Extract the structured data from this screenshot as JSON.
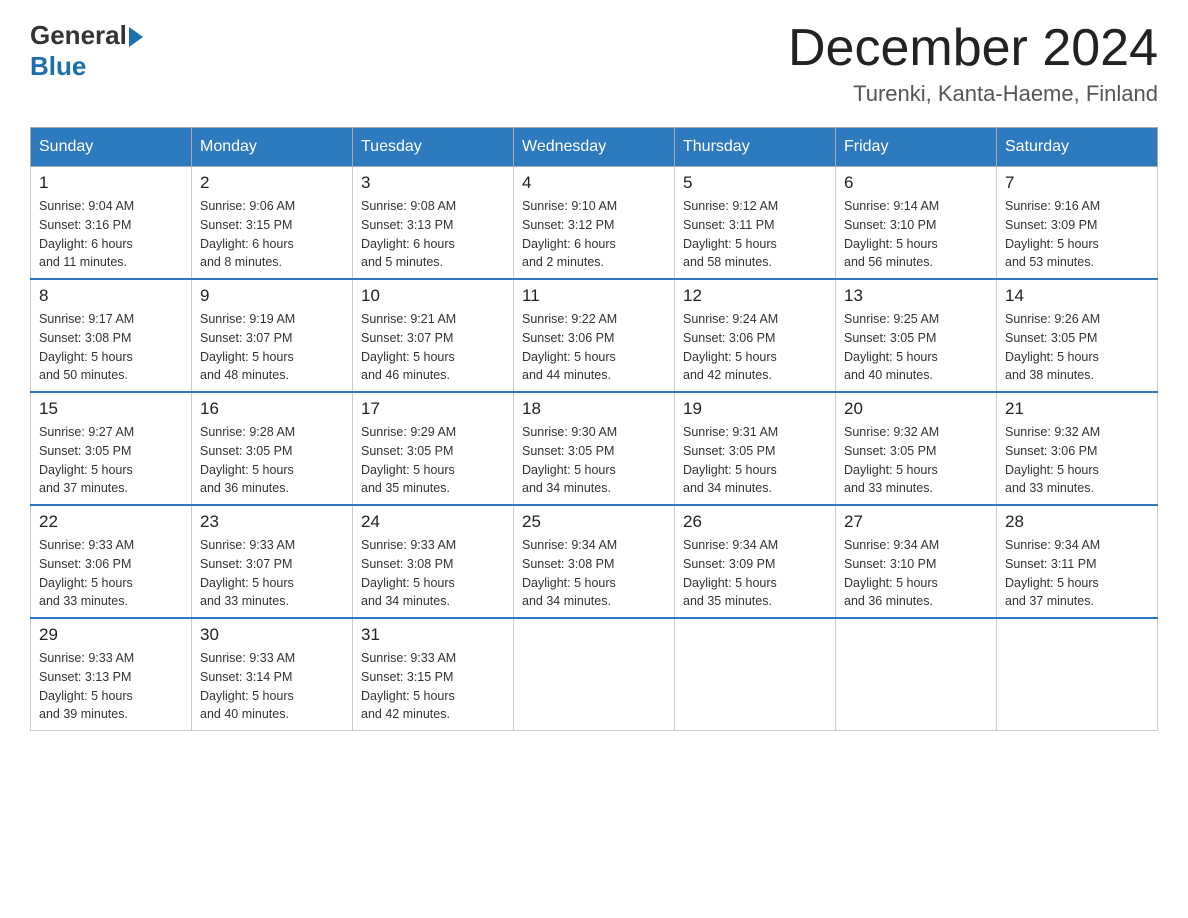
{
  "logo": {
    "general": "General",
    "blue": "Blue"
  },
  "title": "December 2024",
  "location": "Turenki, Kanta-Haeme, Finland",
  "days_of_week": [
    "Sunday",
    "Monday",
    "Tuesday",
    "Wednesday",
    "Thursday",
    "Friday",
    "Saturday"
  ],
  "weeks": [
    [
      {
        "day": "1",
        "sunrise": "9:04 AM",
        "sunset": "3:16 PM",
        "daylight": "6 hours and 11 minutes."
      },
      {
        "day": "2",
        "sunrise": "9:06 AM",
        "sunset": "3:15 PM",
        "daylight": "6 hours and 8 minutes."
      },
      {
        "day": "3",
        "sunrise": "9:08 AM",
        "sunset": "3:13 PM",
        "daylight": "6 hours and 5 minutes."
      },
      {
        "day": "4",
        "sunrise": "9:10 AM",
        "sunset": "3:12 PM",
        "daylight": "6 hours and 2 minutes."
      },
      {
        "day": "5",
        "sunrise": "9:12 AM",
        "sunset": "3:11 PM",
        "daylight": "5 hours and 58 minutes."
      },
      {
        "day": "6",
        "sunrise": "9:14 AM",
        "sunset": "3:10 PM",
        "daylight": "5 hours and 56 minutes."
      },
      {
        "day": "7",
        "sunrise": "9:16 AM",
        "sunset": "3:09 PM",
        "daylight": "5 hours and 53 minutes."
      }
    ],
    [
      {
        "day": "8",
        "sunrise": "9:17 AM",
        "sunset": "3:08 PM",
        "daylight": "5 hours and 50 minutes."
      },
      {
        "day": "9",
        "sunrise": "9:19 AM",
        "sunset": "3:07 PM",
        "daylight": "5 hours and 48 minutes."
      },
      {
        "day": "10",
        "sunrise": "9:21 AM",
        "sunset": "3:07 PM",
        "daylight": "5 hours and 46 minutes."
      },
      {
        "day": "11",
        "sunrise": "9:22 AM",
        "sunset": "3:06 PM",
        "daylight": "5 hours and 44 minutes."
      },
      {
        "day": "12",
        "sunrise": "9:24 AM",
        "sunset": "3:06 PM",
        "daylight": "5 hours and 42 minutes."
      },
      {
        "day": "13",
        "sunrise": "9:25 AM",
        "sunset": "3:05 PM",
        "daylight": "5 hours and 40 minutes."
      },
      {
        "day": "14",
        "sunrise": "9:26 AM",
        "sunset": "3:05 PM",
        "daylight": "5 hours and 38 minutes."
      }
    ],
    [
      {
        "day": "15",
        "sunrise": "9:27 AM",
        "sunset": "3:05 PM",
        "daylight": "5 hours and 37 minutes."
      },
      {
        "day": "16",
        "sunrise": "9:28 AM",
        "sunset": "3:05 PM",
        "daylight": "5 hours and 36 minutes."
      },
      {
        "day": "17",
        "sunrise": "9:29 AM",
        "sunset": "3:05 PM",
        "daylight": "5 hours and 35 minutes."
      },
      {
        "day": "18",
        "sunrise": "9:30 AM",
        "sunset": "3:05 PM",
        "daylight": "5 hours and 34 minutes."
      },
      {
        "day": "19",
        "sunrise": "9:31 AM",
        "sunset": "3:05 PM",
        "daylight": "5 hours and 34 minutes."
      },
      {
        "day": "20",
        "sunrise": "9:32 AM",
        "sunset": "3:05 PM",
        "daylight": "5 hours and 33 minutes."
      },
      {
        "day": "21",
        "sunrise": "9:32 AM",
        "sunset": "3:06 PM",
        "daylight": "5 hours and 33 minutes."
      }
    ],
    [
      {
        "day": "22",
        "sunrise": "9:33 AM",
        "sunset": "3:06 PM",
        "daylight": "5 hours and 33 minutes."
      },
      {
        "day": "23",
        "sunrise": "9:33 AM",
        "sunset": "3:07 PM",
        "daylight": "5 hours and 33 minutes."
      },
      {
        "day": "24",
        "sunrise": "9:33 AM",
        "sunset": "3:08 PM",
        "daylight": "5 hours and 34 minutes."
      },
      {
        "day": "25",
        "sunrise": "9:34 AM",
        "sunset": "3:08 PM",
        "daylight": "5 hours and 34 minutes."
      },
      {
        "day": "26",
        "sunrise": "9:34 AM",
        "sunset": "3:09 PM",
        "daylight": "5 hours and 35 minutes."
      },
      {
        "day": "27",
        "sunrise": "9:34 AM",
        "sunset": "3:10 PM",
        "daylight": "5 hours and 36 minutes."
      },
      {
        "day": "28",
        "sunrise": "9:34 AM",
        "sunset": "3:11 PM",
        "daylight": "5 hours and 37 minutes."
      }
    ],
    [
      {
        "day": "29",
        "sunrise": "9:33 AM",
        "sunset": "3:13 PM",
        "daylight": "5 hours and 39 minutes."
      },
      {
        "day": "30",
        "sunrise": "9:33 AM",
        "sunset": "3:14 PM",
        "daylight": "5 hours and 40 minutes."
      },
      {
        "day": "31",
        "sunrise": "9:33 AM",
        "sunset": "3:15 PM",
        "daylight": "5 hours and 42 minutes."
      },
      null,
      null,
      null,
      null
    ]
  ],
  "labels": {
    "sunrise": "Sunrise:",
    "sunset": "Sunset:",
    "daylight": "Daylight:"
  }
}
